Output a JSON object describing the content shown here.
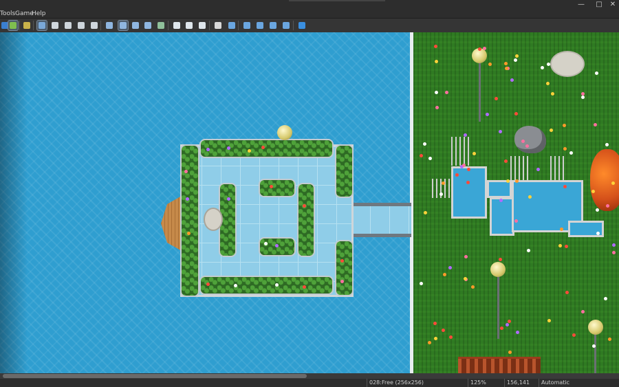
{
  "window": {
    "controls": {
      "minimize": "—",
      "maximize": "□",
      "close": "✕"
    }
  },
  "menu": {
    "items": [
      "Tools",
      "Game",
      "Help"
    ]
  },
  "toolbar": {
    "buttons": [
      {
        "name": "play-icon",
        "color": "#3a7fd0",
        "selected": false
      },
      {
        "name": "map-icon",
        "color": "#7fbf4f",
        "selected": true
      },
      {
        "name": "event-icon",
        "color": "#c9b24a",
        "selected": false
      },
      {
        "name": "layer-a-icon",
        "color": "#7aa8d8",
        "selected": true
      },
      {
        "name": "layer-b-icon",
        "color": "#cfd6dc",
        "selected": false
      },
      {
        "name": "layer-c-icon",
        "color": "#cfd6dc",
        "selected": false
      },
      {
        "name": "layer-d-icon",
        "color": "#cfd6dc",
        "selected": false
      },
      {
        "name": "layer-e-icon",
        "color": "#cfd6dc",
        "selected": false
      },
      {
        "name": "pencil-icon",
        "color": "#8fb6e0",
        "selected": false
      },
      {
        "name": "rectangle-icon",
        "color": "#8fb6e0",
        "selected": true
      },
      {
        "name": "ellipse-icon",
        "color": "#8fb6e0",
        "selected": false
      },
      {
        "name": "fill-icon",
        "color": "#8fb6e0",
        "selected": false
      },
      {
        "name": "shadow-pen-icon",
        "color": "#8fc09a",
        "selected": false
      },
      {
        "name": "zoom-in-icon",
        "color": "#dfe6ec",
        "selected": false
      },
      {
        "name": "zoom-out-icon",
        "color": "#dfe6ec",
        "selected": false
      },
      {
        "name": "zoom-actual-icon",
        "color": "#dfe6ec",
        "selected": false
      },
      {
        "name": "database-icon",
        "color": "#d8d8d8",
        "selected": false
      },
      {
        "name": "plugin-icon",
        "color": "#6aa6e0",
        "selected": false
      },
      {
        "name": "sound-icon",
        "color": "#6aa6e0",
        "selected": false
      },
      {
        "name": "image-icon",
        "color": "#6aa6e0",
        "selected": false
      },
      {
        "name": "character-icon",
        "color": "#6aa6e0",
        "selected": false
      },
      {
        "name": "resource-icon",
        "color": "#6aa6e0",
        "selected": false
      },
      {
        "name": "playtest-icon",
        "color": "#3a8fe0",
        "selected": false
      }
    ]
  },
  "status": {
    "tile": "028:Free (256x256)",
    "zoom": "125%",
    "coords": "156,141",
    "mode": "Automatic"
  },
  "colors": {
    "water": "#2f9ed0",
    "grass": "#2f7a22",
    "flowers": [
      "#ff6fa0",
      "#ffd23a",
      "#ffffff",
      "#ff4a3a",
      "#b06aff",
      "#ff9a2a"
    ]
  }
}
